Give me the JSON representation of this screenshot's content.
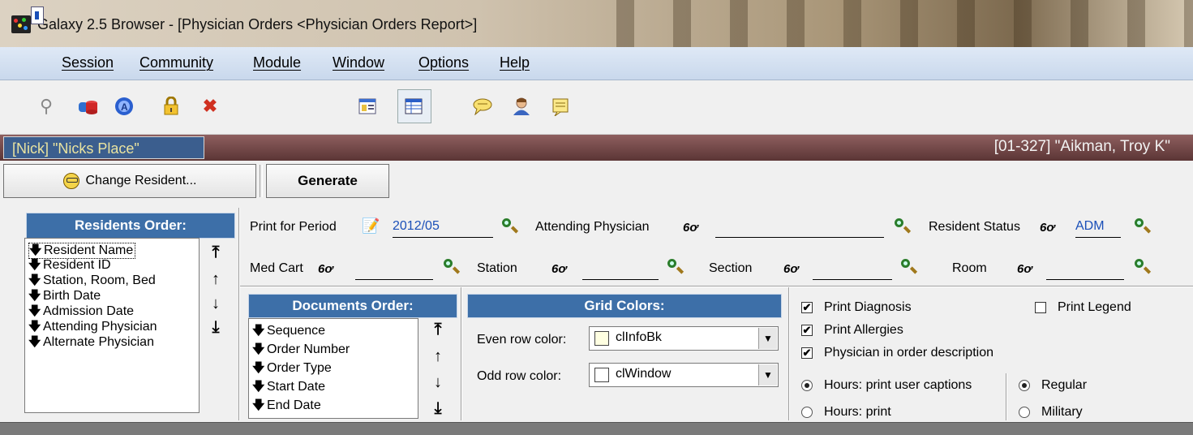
{
  "window": {
    "title": "Galaxy 2.5 Browser - [Physician Orders  <Physician Orders Report>]"
  },
  "menu": {
    "items": [
      "Session",
      "Community",
      "Module",
      "Window",
      "Options",
      "Help"
    ]
  },
  "context": {
    "facility": "[Nick] \"Nicks Place\"",
    "resident": "[01-327] \"Aikman, Troy K\""
  },
  "actions": {
    "change_resident": "Change Resident...",
    "generate": "Generate"
  },
  "residents_order": {
    "title": "Residents Order:",
    "items": [
      "Resident Name",
      "Resident ID",
      "Station, Room, Bed",
      "Birth Date",
      "Admission Date",
      "Attending Physician",
      "Alternate Physician"
    ]
  },
  "filters": {
    "print_for_period_label": "Print for Period",
    "print_for_period_value": "2012/05",
    "attending_physician_label": "Attending Physician",
    "attending_physician_value": "",
    "resident_status_label": "Resident Status",
    "resident_status_value": "ADM",
    "med_cart_label": "Med Cart",
    "station_label": "Station",
    "section_label": "Section",
    "room_label": "Room",
    "glasses_glyph": "6ơ"
  },
  "documents_order": {
    "title": "Documents Order:",
    "items": [
      "Sequence",
      "Order Number",
      "Order Type",
      "Start Date",
      "End Date"
    ]
  },
  "grid_colors": {
    "title": "Grid Colors:",
    "even_label": "Even row color:",
    "even_value": "clInfoBk",
    "even_color": "#ffffe1",
    "odd_label": "Odd row color:",
    "odd_value": "clWindow",
    "odd_color": "#ffffff"
  },
  "options": {
    "print_diagnosis": "Print Diagnosis",
    "print_legend": "Print Legend",
    "print_allergies": "Print Allergies",
    "physician_in_desc": "Physician in order description",
    "hours_user_captions": "Hours: print user captions",
    "hours_print": "Hours: print",
    "regular": "Regular",
    "military": "Military",
    "checked": {
      "print_diagnosis": true,
      "print_legend": false,
      "print_allergies": true,
      "physician_in_desc": true
    },
    "hours_selected": "Hours: print user captions",
    "time_format_selected": "Regular"
  }
}
